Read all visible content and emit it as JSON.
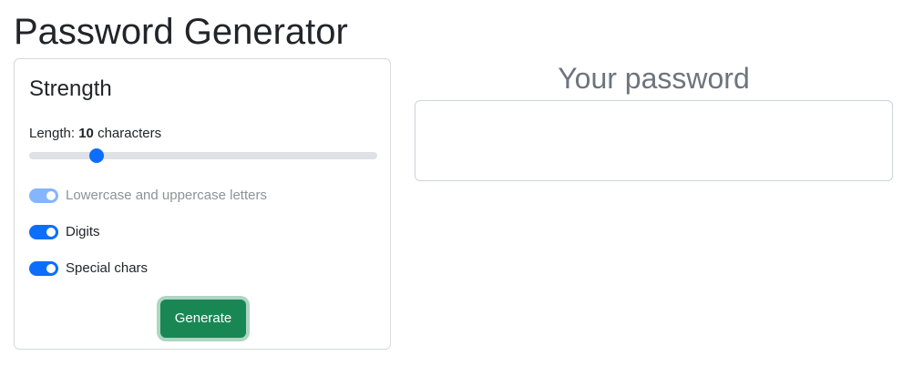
{
  "page": {
    "title": "Password Generator"
  },
  "strength_card": {
    "title": "Strength",
    "length": {
      "prefix": "Length: ",
      "value": "10",
      "suffix": " characters",
      "slider_fraction": 0.18
    },
    "options": [
      {
        "label": "Lowercase and uppercase letters",
        "checked": true,
        "disabled": true
      },
      {
        "label": "Digits",
        "checked": true,
        "disabled": false
      },
      {
        "label": "Special chars",
        "checked": true,
        "disabled": false
      }
    ],
    "generate_label": "Generate"
  },
  "result": {
    "title": "Your password",
    "password_value": ""
  },
  "colors": {
    "primary": "#0d6efd",
    "success": "#198754",
    "muted": "#6c757d"
  }
}
